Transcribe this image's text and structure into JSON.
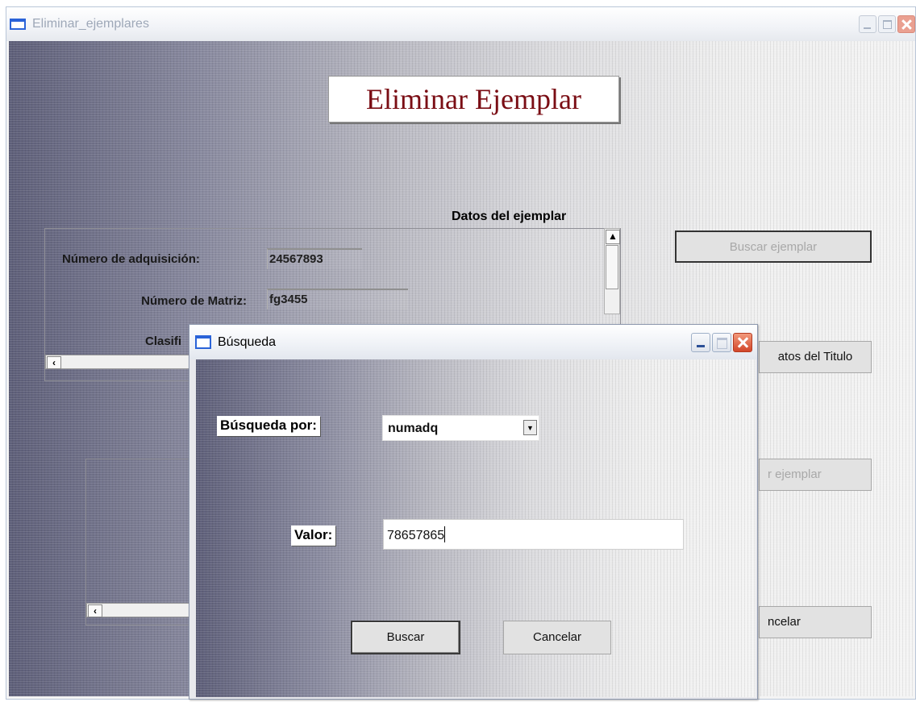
{
  "main_window": {
    "title": "Eliminar_ejemplares",
    "heading": "Eliminar Ejemplar",
    "section_label": "Datos del ejemplar",
    "fields": [
      {
        "label": "Número de adquisición:",
        "value": "24567893"
      },
      {
        "label": "Número de Matriz:",
        "value": "fg3455"
      },
      {
        "label": "Clasifi",
        "value": ""
      }
    ],
    "buttons": {
      "buscar_ejemplar": "Buscar ejemplar",
      "datos_titulo": "atos del Titulo",
      "eliminar_ejemplar": "r ejemplar",
      "cancelar": "ncelar"
    }
  },
  "dialog": {
    "title": "Búsqueda",
    "search_by_label": "Búsqueda por:",
    "search_by_value": "numadq",
    "value_label": "Valor:",
    "value_input": "78657865",
    "buscar_button": "Buscar",
    "cancelar_button": "Cancelar"
  },
  "colors": {
    "heading_text": "#7a0d14",
    "titlebar_icon": "#2a63d8",
    "close_button": "#d2462a"
  }
}
